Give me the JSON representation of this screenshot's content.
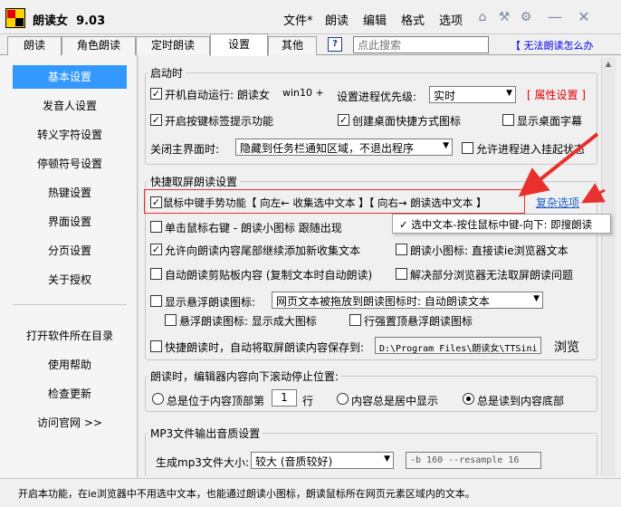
{
  "titlebar": {
    "app_name": "朗读女",
    "version": "9.03",
    "menus": [
      "文件*",
      "朗读",
      "编辑",
      "格式",
      "选项"
    ],
    "icons": [
      "home-icon",
      "tools-icon",
      "pin-icon",
      "minimize-icon",
      "close-icon"
    ]
  },
  "tabs": [
    "朗读",
    "角色朗读",
    "定时朗读",
    "设置",
    "其他"
  ],
  "active_tab": "设置",
  "search": {
    "placeholder": "点此搜索"
  },
  "help_link": "【 无法朗读怎么办",
  "sidebar": {
    "items": [
      "基本设置",
      "发音人设置",
      "转义字符设置",
      "停顿符号设置",
      "热键设置",
      "界面设置",
      "分页设置",
      "关于授权"
    ],
    "active": "基本设置",
    "links": [
      "打开软件所在目录",
      "使用帮助",
      "检查更新",
      "访问官网 >>"
    ]
  },
  "startup": {
    "title": "启动时",
    "autorun": {
      "label": "开机自动运行: 朗读女",
      "checked": true,
      "os": "win10 +"
    },
    "priority_label": "设置进程优先级:",
    "priority_value": "实时",
    "attr_link": "[ 属性设置 ]",
    "hotkey_tip": {
      "label": "开启按键标签提示功能",
      "checked": true
    },
    "desktop_shortcut": {
      "label": "创建桌面快捷方式图标",
      "checked": true
    },
    "desktop_subtitle": {
      "label": "显示桌面字幕",
      "checked": false
    },
    "close_main_label": "关闭主界面时:",
    "close_main_value": "隐藏到任务栏通知区域，不退出程序",
    "allow_tray": {
      "label": "允许进程进入挂起状态",
      "checked": false
    }
  },
  "quick": {
    "title": "快捷取屏朗读设置",
    "gesture": {
      "label": "鼠标中键手势功能【 向左← 收集选中文本 】【 向右→ 朗读选中文本 】",
      "checked": true
    },
    "complex_link": "复杂选项",
    "popup_item": "选中文本-按住鼠标中键-向下: 即搜朗读",
    "right_click": {
      "label": "单击鼠标右键 - 朗读小图标 跟随出现",
      "checked": false
    },
    "append_end": {
      "label": "允许向朗读内容尾部继续添加新收集文本",
      "checked": true
    },
    "small_icon_ie": {
      "label": "朗读小图标: 直接读ie浏览器文本",
      "checked": false
    },
    "auto_clipboard": {
      "label": "自动朗读剪贴板内容 (复制文本时自动朗读)",
      "checked": false
    },
    "fix_browser": {
      "label": "解决部分浏览器无法取屏朗读问题",
      "checked": false
    },
    "float_icon": {
      "label": "显示悬浮朗读图标:",
      "checked": false
    },
    "float_drop_value": "网页文本被拖放到朗读图标时: 自动朗读文本",
    "float_show_big": {
      "label": "悬浮朗读图标: 显示成大图标",
      "checked": false
    },
    "float_pin": {
      "label": "行强置顶悬浮朗读图标",
      "checked": false
    },
    "quick_save": {
      "label": "快捷朗读时，自动将取屏朗读内容保存到:",
      "checked": false
    },
    "save_path": "D:\\Program Files\\朗读女\\TTSini",
    "browse": "浏览"
  },
  "scroll": {
    "title": "朗读时，编辑器内容向下滚动停止位置:",
    "opt_top": "总是位于内容顶部第",
    "opt_top_value": "1",
    "opt_top_unit": "行",
    "opt_center": "内容总是居中显示",
    "opt_bottom": "总是读到内容底部",
    "selected": "opt_bottom"
  },
  "mp3": {
    "title": "MP3文件输出音质设置",
    "size_label": "生成mp3文件大小:",
    "size_value": "较大 (音质较好)",
    "params": "-b 160 --resample 16"
  },
  "status": {
    "text": "开启本功能，在ie浏览器中不用选中文本，也能通过朗读小图标，朗读鼠标所在网页元素区域内的文本。"
  },
  "colors": {
    "accent": "#3399ff",
    "annotation": "#e8312f",
    "link": "#1e5fc8"
  }
}
